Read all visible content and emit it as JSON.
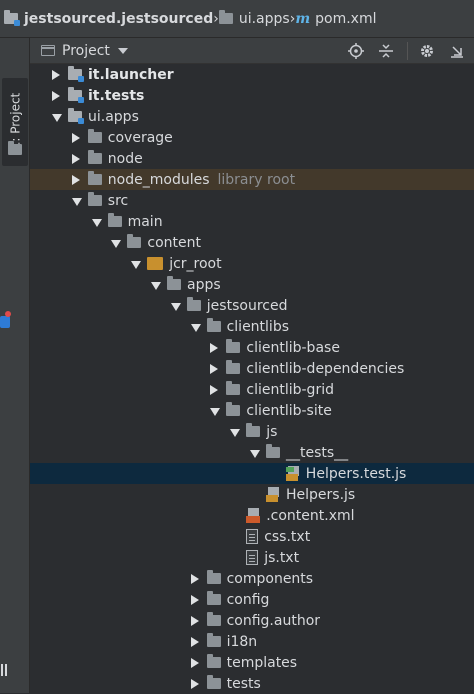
{
  "breadcrumb": {
    "items": [
      {
        "label": "jestsourced.jestsourced",
        "icon": "module-folder-icon"
      },
      {
        "label": "ui.apps",
        "icon": "folder-icon"
      },
      {
        "label": "pom.xml",
        "icon": "maven-icon"
      }
    ],
    "maven_glyph": "m",
    "separator": "›"
  },
  "sidebar": {
    "tab_label": "1: Project"
  },
  "panel": {
    "title": "Project",
    "tools": [
      "locate-icon",
      "collapse-icon",
      "gear-icon",
      "hide-icon"
    ]
  },
  "tree": [
    {
      "label": "it.launcher",
      "depth": 1,
      "state": "collapsed",
      "icon": "module-folder",
      "bold": true
    },
    {
      "label": "it.tests",
      "depth": 1,
      "state": "collapsed",
      "icon": "module-folder",
      "bold": true
    },
    {
      "label": "ui.apps",
      "depth": 1,
      "state": "expanded",
      "icon": "module-folder"
    },
    {
      "label": "coverage",
      "depth": 2,
      "state": "collapsed",
      "icon": "folder"
    },
    {
      "label": "node",
      "depth": 2,
      "state": "collapsed",
      "icon": "folder"
    },
    {
      "label": "node_modules",
      "suffix": "library root",
      "depth": 2,
      "state": "collapsed",
      "icon": "folder",
      "highlight": "lib"
    },
    {
      "label": "src",
      "depth": 2,
      "state": "expanded",
      "icon": "folder"
    },
    {
      "label": "main",
      "depth": 3,
      "state": "expanded",
      "icon": "folder"
    },
    {
      "label": "content",
      "depth": 4,
      "state": "expanded",
      "icon": "folder"
    },
    {
      "label": "jcr_root",
      "depth": 5,
      "state": "expanded",
      "icon": "jcr"
    },
    {
      "label": "apps",
      "depth": 6,
      "state": "expanded",
      "icon": "folder"
    },
    {
      "label": "jestsourced",
      "depth": 7,
      "state": "expanded",
      "icon": "folder"
    },
    {
      "label": "clientlibs",
      "depth": 8,
      "state": "expanded",
      "icon": "folder"
    },
    {
      "label": "clientlib-base",
      "depth": 9,
      "state": "collapsed",
      "icon": "folder"
    },
    {
      "label": "clientlib-dependencies",
      "depth": 9,
      "state": "collapsed",
      "icon": "folder"
    },
    {
      "label": "clientlib-grid",
      "depth": 9,
      "state": "collapsed",
      "icon": "folder"
    },
    {
      "label": "clientlib-site",
      "depth": 9,
      "state": "expanded",
      "icon": "folder"
    },
    {
      "label": "js",
      "depth": 10,
      "state": "expanded",
      "icon": "folder"
    },
    {
      "label": "__tests__",
      "depth": 11,
      "state": "expanded",
      "icon": "folder"
    },
    {
      "label": "Helpers.test.js",
      "depth": 12,
      "state": "leaf",
      "icon": "js-test",
      "selected": true
    },
    {
      "label": "Helpers.js",
      "depth": 11,
      "state": "leaf",
      "icon": "js"
    },
    {
      "label": ".content.xml",
      "depth": 10,
      "state": "leaf",
      "icon": "xml"
    },
    {
      "label": "css.txt",
      "depth": 10,
      "state": "leaf",
      "icon": "text"
    },
    {
      "label": "js.txt",
      "depth": 10,
      "state": "leaf",
      "icon": "text"
    },
    {
      "label": "components",
      "depth": 8,
      "state": "collapsed",
      "icon": "folder"
    },
    {
      "label": "config",
      "depth": 8,
      "state": "collapsed",
      "icon": "folder"
    },
    {
      "label": "config.author",
      "depth": 8,
      "state": "collapsed",
      "icon": "folder"
    },
    {
      "label": "i18n",
      "depth": 8,
      "state": "collapsed",
      "icon": "folder"
    },
    {
      "label": "templates",
      "depth": 8,
      "state": "collapsed",
      "icon": "folder"
    },
    {
      "label": "tests",
      "depth": 8,
      "state": "collapsed",
      "icon": "folder"
    }
  ],
  "colors": {
    "background": "#2b2d30",
    "selection": "#0d293e",
    "library_highlight": "#43392b",
    "js_badge": "#c8902e",
    "xml_badge": "#cc5a2b"
  }
}
